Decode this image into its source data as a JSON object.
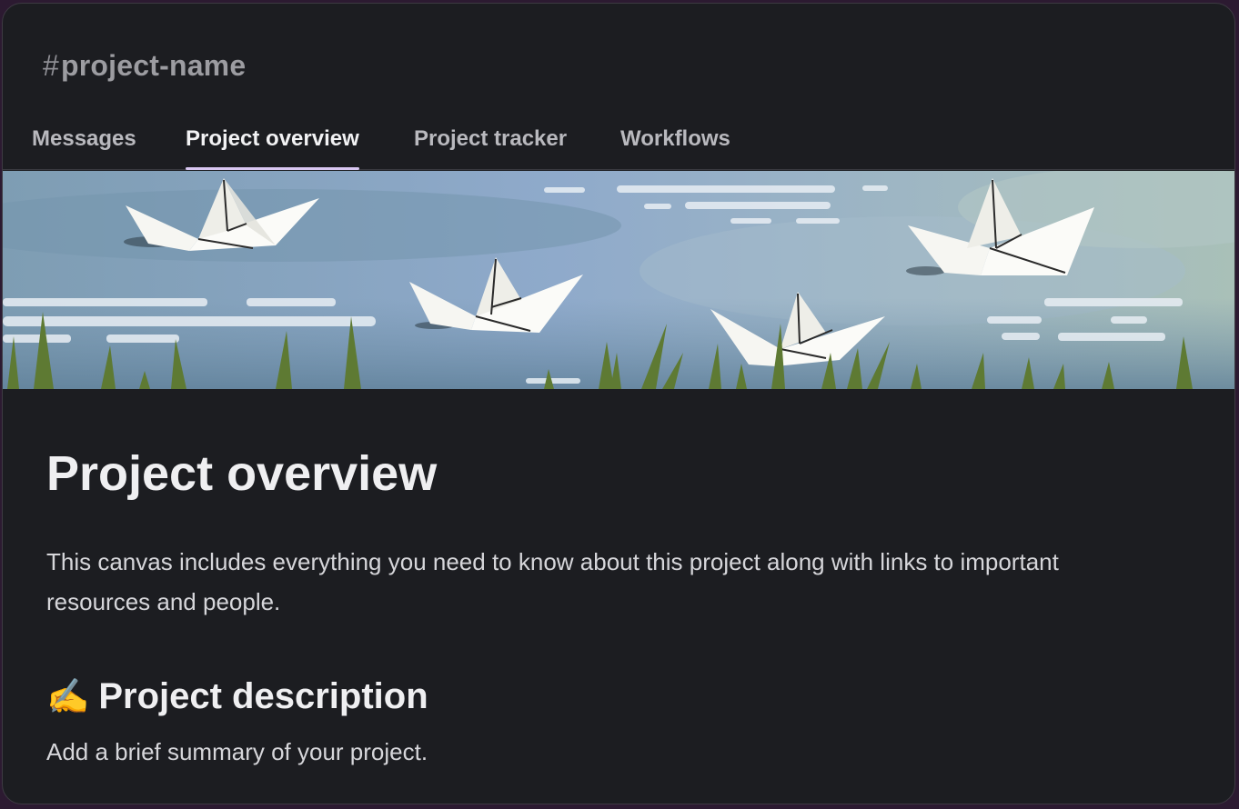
{
  "channel": {
    "hash": "#",
    "name": "project-name"
  },
  "tabs": [
    {
      "label": "Messages",
      "active": false
    },
    {
      "label": "Project overview",
      "active": true
    },
    {
      "label": "Project tracker",
      "active": false
    },
    {
      "label": "Workflows",
      "active": false
    }
  ],
  "banner": {
    "description_icon": "paper-boats-illustration"
  },
  "canvas": {
    "title": "Project overview",
    "intro": "This canvas includes everything you need to know about this project along with links to important resources and people.",
    "section": {
      "emoji": "✍️",
      "title": "Project description",
      "body": "Add a brief summary of your project."
    }
  },
  "colors": {
    "background": "#1c1d21",
    "tab_underline": "#d9c7f2",
    "outer": "#2c1a31"
  }
}
